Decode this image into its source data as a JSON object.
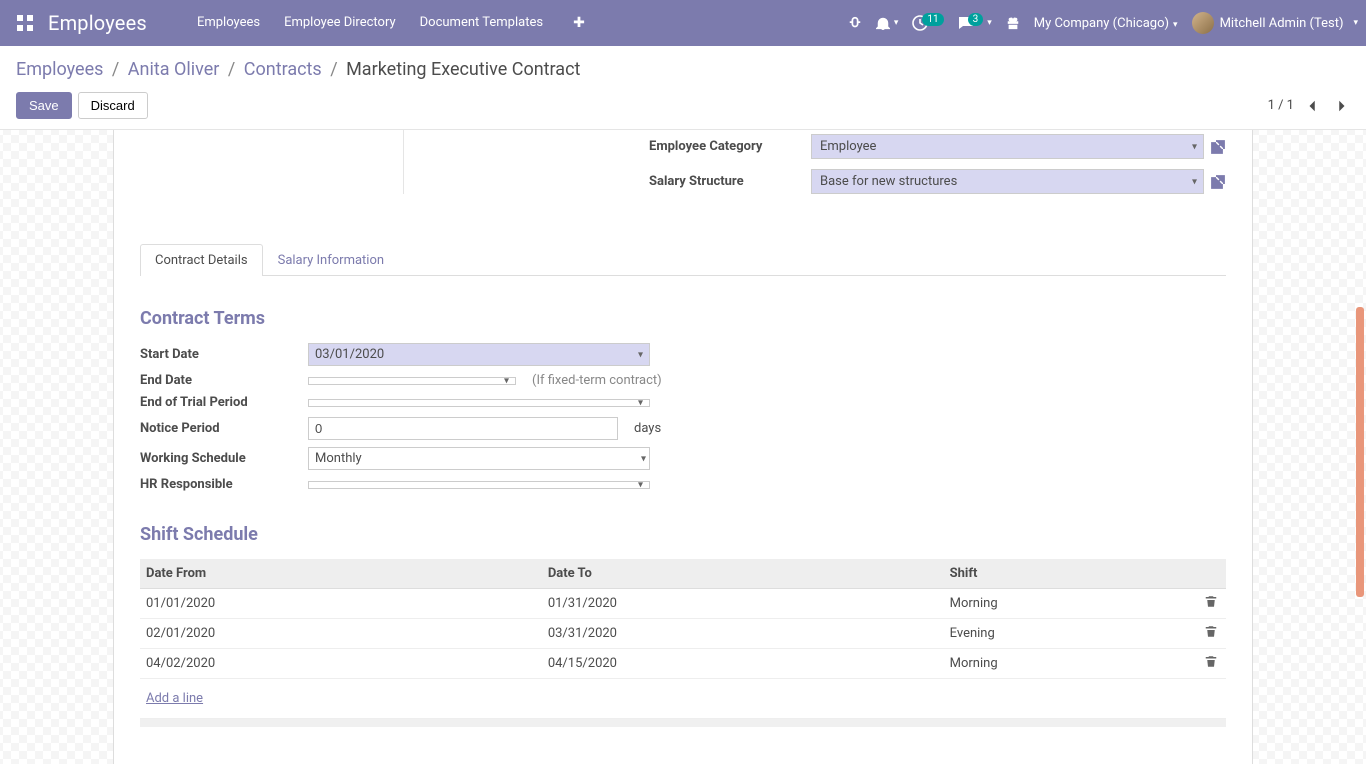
{
  "navbar": {
    "brand": "Employees",
    "menu": [
      "Employees",
      "Employee Directory",
      "Document Templates"
    ],
    "badges": {
      "activity": "11",
      "messages": "3"
    },
    "company": "My Company (Chicago)",
    "user": "Mitchell Admin (Test)"
  },
  "breadcrumb": {
    "items": [
      "Employees",
      "Anita Oliver",
      "Contracts"
    ],
    "current": "Marketing Executive Contract"
  },
  "buttons": {
    "save": "Save",
    "discard": "Discard"
  },
  "pager": {
    "text": "1 / 1"
  },
  "upper_fields": {
    "emp_cat_label": "Employee Category",
    "emp_cat_value": "Employee",
    "sal_struct_label": "Salary Structure",
    "sal_struct_value": "Base for new structures"
  },
  "tabs": {
    "t1": "Contract Details",
    "t2": "Salary Information"
  },
  "terms": {
    "heading": "Contract Terms",
    "start_label": "Start Date",
    "start_value": "03/01/2020",
    "end_label": "End Date",
    "end_value": "",
    "end_hint": "(If fixed-term contract)",
    "trial_label": "End of Trial Period",
    "trial_value": "",
    "notice_label": "Notice Period",
    "notice_value": "0",
    "notice_suffix": "days",
    "sched_label": "Working Schedule",
    "sched_value": "Monthly",
    "hr_label": "HR Responsible",
    "hr_value": ""
  },
  "shift": {
    "heading": "Shift Schedule",
    "headers": {
      "from": "Date From",
      "to": "Date To",
      "shift": "Shift"
    },
    "rows": [
      {
        "from": "01/01/2020",
        "to": "01/31/2020",
        "shift": "Morning"
      },
      {
        "from": "02/01/2020",
        "to": "03/31/2020",
        "shift": "Evening"
      },
      {
        "from": "04/02/2020",
        "to": "04/15/2020",
        "shift": "Morning"
      }
    ],
    "add_line": "Add a line"
  }
}
